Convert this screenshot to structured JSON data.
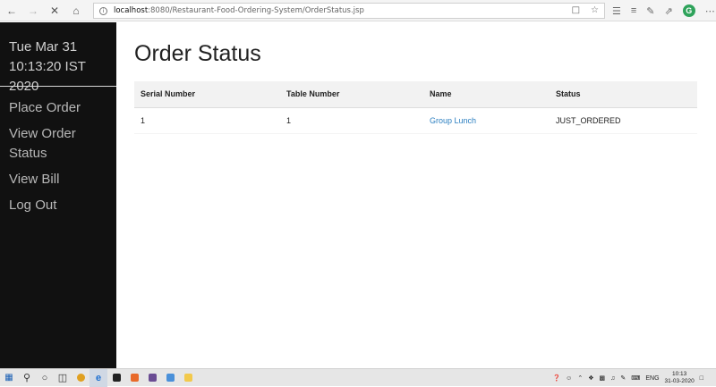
{
  "browser": {
    "url_host": "localhost",
    "url_path": ":8080/Restaurant-Food-Ordering-System/OrderStatus.jsp",
    "back_icon": "arrow-left-icon",
    "forward_icon": "arrow-right-icon",
    "stop_icon": "close-icon",
    "home_icon": "home-icon"
  },
  "sidebar": {
    "date_line1": "Tue Mar 31",
    "date_line2": "10:13:20 IST 2020",
    "menu": [
      {
        "label": "Place Order"
      },
      {
        "label": "View Order Status"
      },
      {
        "label": "View Bill"
      },
      {
        "label": "Log Out"
      }
    ]
  },
  "main": {
    "title": "Order Status",
    "table": {
      "headers": [
        "Serial Number",
        "Table Number",
        "Name",
        "Status"
      ],
      "rows": [
        {
          "serial": "1",
          "table": "1",
          "name": "Group Lunch",
          "status": "JUST_ORDERED"
        }
      ]
    }
  },
  "taskbar": {
    "language": "ENG",
    "time": "10:13",
    "date": "31-03-2020"
  },
  "colors": {
    "sidebar_bg": "#111111",
    "link": "#2b7fc1",
    "serial": "#2e7d32"
  }
}
